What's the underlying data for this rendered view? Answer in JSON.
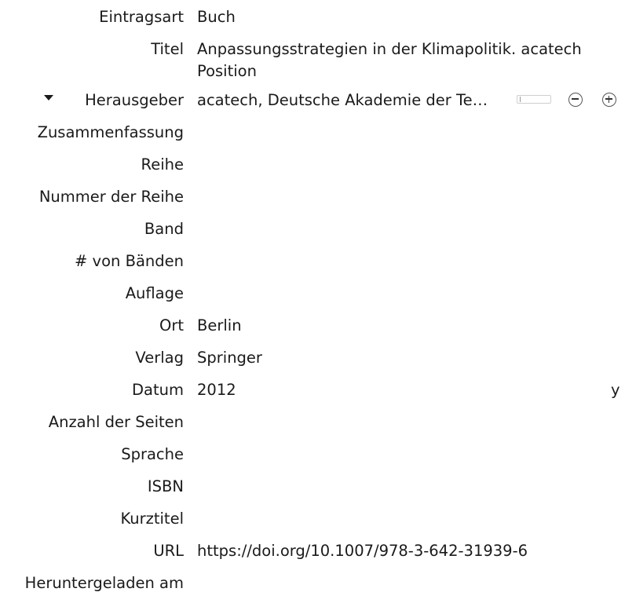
{
  "fields": [
    {
      "key": "item_type",
      "label": "Eintragsart",
      "value": "Buch"
    },
    {
      "key": "title",
      "label": "Titel",
      "value": "Anpassungsstrategien in der Klimapolitik. acatech Position"
    },
    {
      "key": "creator",
      "label": "Herausgeber",
      "value": "acatech, Deutsche Akademie der Te…"
    },
    {
      "key": "abstract",
      "label": "Zusammenfassung",
      "value": ""
    },
    {
      "key": "series",
      "label": "Reihe",
      "value": ""
    },
    {
      "key": "series_number",
      "label": "Nummer der Reihe",
      "value": ""
    },
    {
      "key": "volume",
      "label": "Band",
      "value": ""
    },
    {
      "key": "num_volumes",
      "label": "# von Bänden",
      "value": ""
    },
    {
      "key": "edition",
      "label": "Auflage",
      "value": ""
    },
    {
      "key": "place",
      "label": "Ort",
      "value": "Berlin"
    },
    {
      "key": "publisher",
      "label": "Verlag",
      "value": "Springer"
    },
    {
      "key": "date",
      "label": "Datum",
      "value": "2012",
      "hint": "y"
    },
    {
      "key": "num_pages",
      "label": "Anzahl der Seiten",
      "value": ""
    },
    {
      "key": "language",
      "label": "Sprache",
      "value": ""
    },
    {
      "key": "isbn",
      "label": "ISBN",
      "value": ""
    },
    {
      "key": "short_title",
      "label": "Kurztitel",
      "value": ""
    },
    {
      "key": "url",
      "label": "URL",
      "value": "https://doi.org/10.1007/978-3-642-31939-6"
    },
    {
      "key": "access_date",
      "label": "Heruntergeladen am",
      "value": ""
    }
  ],
  "icons": {
    "creator_toggle": "triangle-down-icon",
    "switch_mode": "switch-field-mode-icon",
    "remove_creator": "minus-circle-icon",
    "add_creator": "plus-circle-icon"
  }
}
